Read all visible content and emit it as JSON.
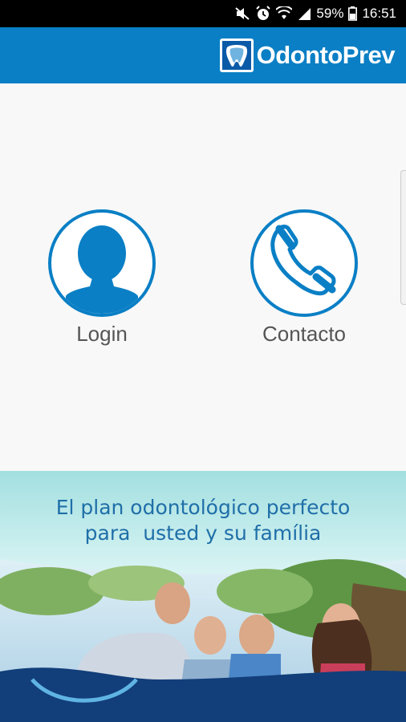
{
  "status_bar": {
    "battery_percent": "59%",
    "time": "16:51",
    "icons": [
      "mute-icon",
      "alarm-icon",
      "wifi-icon",
      "signal-icon",
      "battery-icon"
    ]
  },
  "header": {
    "brand_name": "OdontoPrev",
    "background_color": "#0a7fc5"
  },
  "actions": [
    {
      "id": "login",
      "label": "Login",
      "icon": "user-icon"
    },
    {
      "id": "contact",
      "label": "Contacto",
      "icon": "phone-icon"
    }
  ],
  "promo": {
    "line1": "El plan odontológico perfecto",
    "line2": "para  usted y su família",
    "accent_color": "#1f6fa8"
  }
}
